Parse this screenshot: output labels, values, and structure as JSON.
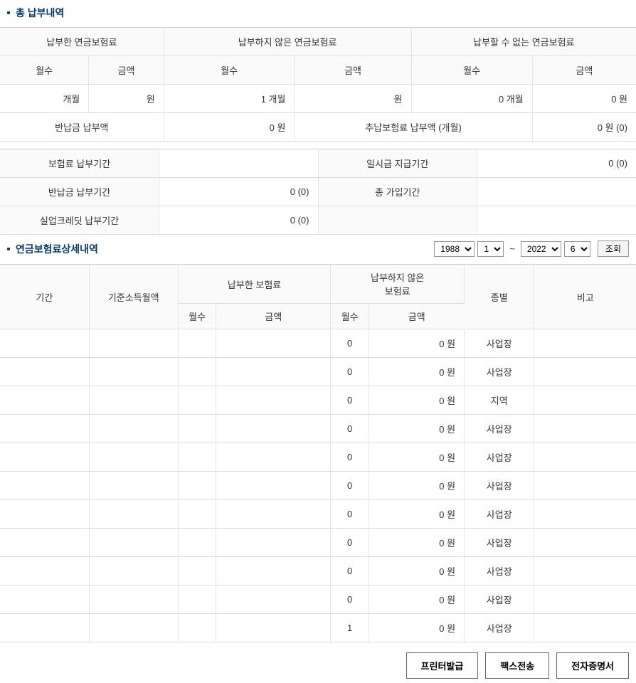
{
  "titles": {
    "section1": "총 납부내역",
    "section2": "연금보험료상세내역"
  },
  "summary": {
    "headers": {
      "h1": "납부한 연금보험료",
      "h2": "납부하지 않은 연금보험료",
      "h3": "납부할 수 없는 연금보험료",
      "col_month": "월수",
      "col_amount": "금액"
    },
    "row1": {
      "paid_months": "개월",
      "paid_amount": "원",
      "unpaid_months": "1 개월",
      "unpaid_amount": "원",
      "excl_months": "0 개월",
      "excl_amount": "0 원"
    },
    "row2": {
      "label1": "반납금 납부액",
      "val1": "0 원",
      "label2": "추납보험료 납부액 (개월)",
      "val2": "0 원 (0)"
    }
  },
  "periods": {
    "r1l": "보험료 납부기간",
    "r1v1": "",
    "r1l2": "일시금 지급기간",
    "r1v2": "0 (0)",
    "r2l": "반납금 납부기간",
    "r2v1": "0 (0)",
    "r2l2": "총 가입기간",
    "r2v2": "",
    "r3l": "실업크레딧 납부기간",
    "r3v1": "0 (0)"
  },
  "filter": {
    "year_from": "1988",
    "month_from": "1",
    "year_to": "2022",
    "month_to": "6",
    "tilde": "~",
    "lookup": "조회"
  },
  "detail_headers": {
    "period": "기간",
    "base_income": "기준소득월액",
    "paid": "납부한 보험료",
    "unpaid": "납부하지 않은\n보험료",
    "type": "종별",
    "remark": "비고",
    "months": "월수",
    "amount": "금액"
  },
  "detail_rows": [
    {
      "months": "0",
      "amount": "0 원",
      "type": "사업장"
    },
    {
      "months": "0",
      "amount": "0 원",
      "type": "사업장"
    },
    {
      "months": "0",
      "amount": "0 원",
      "type": "지역"
    },
    {
      "months": "0",
      "amount": "0 원",
      "type": "사업장"
    },
    {
      "months": "0",
      "amount": "0 원",
      "type": "사업장"
    },
    {
      "months": "0",
      "amount": "0 원",
      "type": "사업장"
    },
    {
      "months": "0",
      "amount": "0 원",
      "type": "사업장"
    },
    {
      "months": "0",
      "amount": "0 원",
      "type": "사업장"
    },
    {
      "months": "0",
      "amount": "0 원",
      "type": "사업장"
    },
    {
      "months": "0",
      "amount": "0 원",
      "type": "사업장"
    },
    {
      "months": "1",
      "amount": "0 원",
      "type": "사업장"
    }
  ],
  "footer": {
    "print": "프린터발급",
    "fax": "팩스전송",
    "cert": "전자증명서"
  }
}
